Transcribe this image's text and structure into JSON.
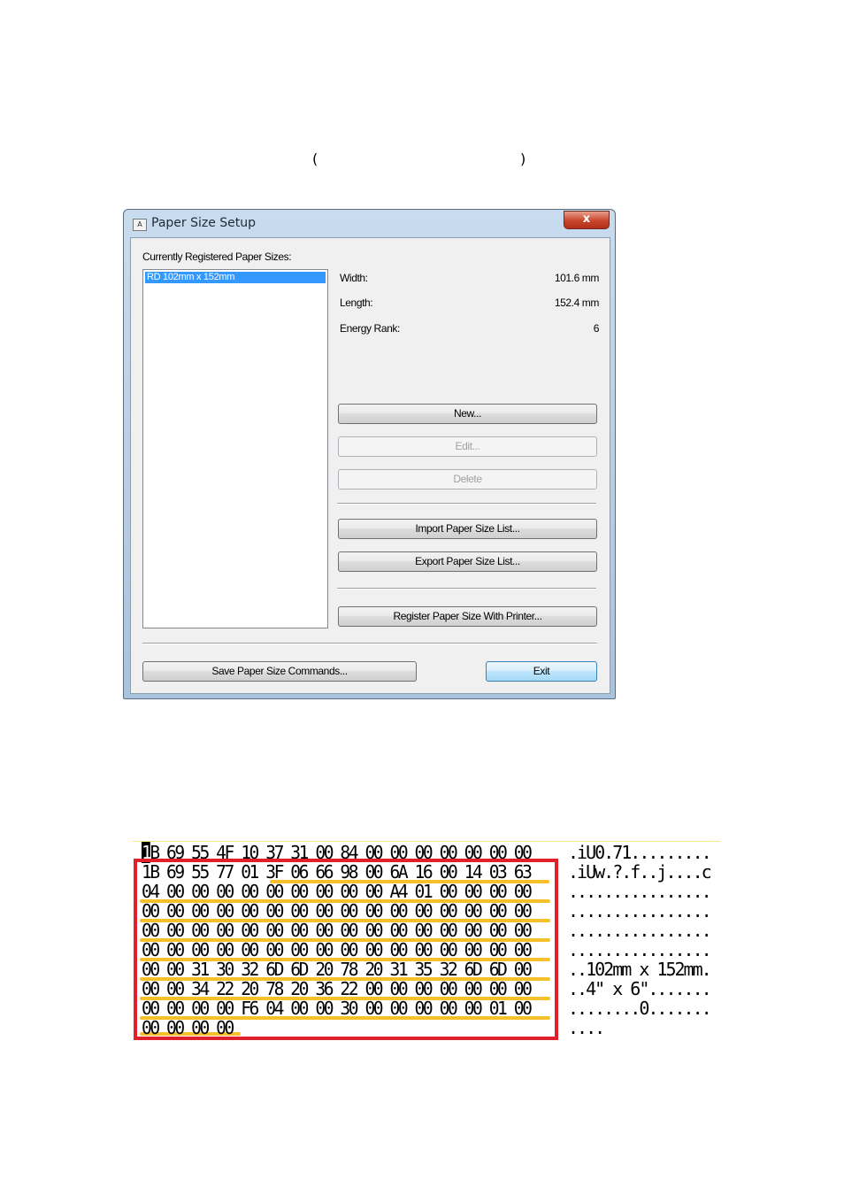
{
  "heading": {
    "open_paren": "(",
    "close_paren": ")"
  },
  "dialog": {
    "title": "Paper Size Setup",
    "close_label": "x",
    "list_label": "Currently Registered Paper Sizes:",
    "list_items": [
      "RD 102mm x 152mm"
    ],
    "info": {
      "width_label": "Width:",
      "width_value": "101.6 mm",
      "length_label": "Length:",
      "length_value": "152.4 mm",
      "energy_label": "Energy Rank:",
      "energy_value": "6"
    },
    "buttons": {
      "new": "New...",
      "edit": "Edit...",
      "delete": "Delete",
      "import": "Import Paper Size List...",
      "export": "Export Paper Size List...",
      "register": "Register Paper Size With Printer...",
      "save": "Save Paper Size Commands...",
      "exit": "Exit"
    }
  },
  "hexdump": {
    "cursor_char": "1",
    "hex_first_rest": "B 69 55 4F 10 37 31 00 84 00 00 00 00 00 00 00",
    "hex_rows": [
      "1B 69 55 77 01 3F 06 66 98 00 6A 16 00 14 03 63",
      "04 00 00 00 00 00 00 00 00 00 A4 01 00 00 00 00",
      "00 00 00 00 00 00 00 00 00 00 00 00 00 00 00 00",
      "00 00 00 00 00 00 00 00 00 00 00 00 00 00 00 00",
      "00 00 00 00 00 00 00 00 00 00 00 00 00 00 00 00",
      "00 00 31 30 32 6D 6D 20 78 20 31 35 32 6D 6D 00",
      "00 00 34 22 20 78 20 36 22 00 00 00 00 00 00 00",
      "00 00 00 00 F6 04 00 00 30 00 00 00 00 00 01 00",
      "00 00 00 00"
    ],
    "ascii_rows": [
      ".iU0.71.........",
      ".iUw.?.f..j....c",
      "................",
      "................",
      "................",
      "................",
      "..102mm x 152mm.",
      "..4\" x 6\".......",
      "........0.......",
      "...."
    ]
  }
}
